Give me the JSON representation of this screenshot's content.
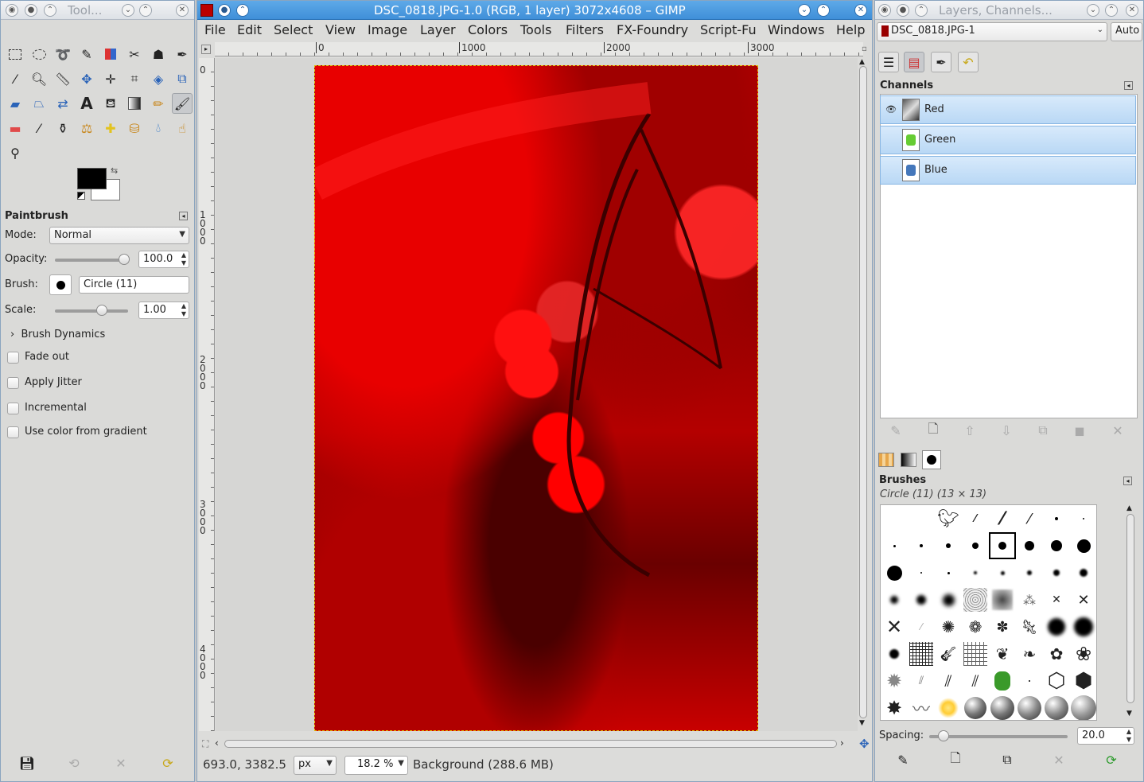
{
  "toolbox": {
    "title": "Tool...",
    "section": "Paintbrush",
    "mode_label": "Mode:",
    "mode_value": "Normal",
    "opacity_label": "Opacity:",
    "opacity_value": "100.0",
    "opacity_fraction": 1.0,
    "brush_label": "Brush:",
    "brush_value": "Circle (11)",
    "scale_label": "Scale:",
    "scale_value": "1.00",
    "dynamics_label": "Brush Dynamics",
    "fade_out": "Fade out",
    "apply_jitter": "Apply Jitter",
    "incremental": "Incremental",
    "use_color": "Use color from gradient"
  },
  "image_window": {
    "title": "DSC_0818.JPG-1.0 (RGB, 1 layer) 3072x4608 – GIMP",
    "menu": [
      "File",
      "Edit",
      "Select",
      "View",
      "Image",
      "Layer",
      "Colors",
      "Tools",
      "Filters",
      "FX-Foundry",
      "Script-Fu",
      "Windows",
      "Help"
    ],
    "ruler_h": [
      "0",
      "1000",
      "2000",
      "3000"
    ],
    "ruler_v": [
      "0",
      "1000",
      "2000",
      "3000",
      "4000"
    ],
    "coords": "693.0, 3382.5",
    "unit": "px",
    "zoom": "18.2 %",
    "status": "Background (288.6 MB)"
  },
  "dock": {
    "title": "Layers, Channels...",
    "image_select": "DSC_0818.JPG-1",
    "auto_button": "Auto",
    "channels_title": "Channels",
    "channels": [
      "Red",
      "Green",
      "Blue"
    ],
    "brushes_title": "Brushes",
    "brush_info": "Circle (11) (13 × 13)",
    "spacing_label": "Spacing:",
    "spacing_value": "20.0"
  },
  "colors": {
    "fg": "#000000",
    "bg": "#ffffff",
    "accent": "#3f8fd8",
    "canvas_red": "#d40000"
  }
}
